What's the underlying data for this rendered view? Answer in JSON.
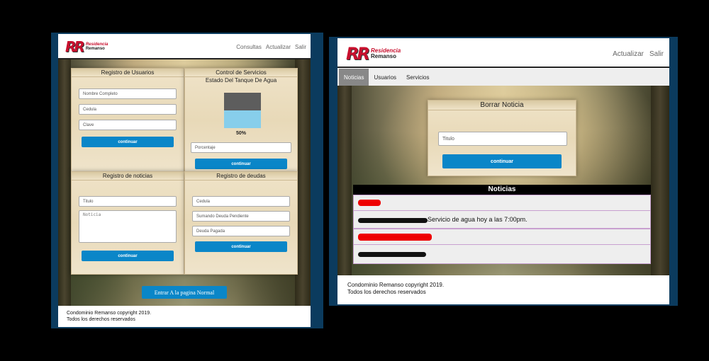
{
  "left": {
    "logo": {
      "mark": "RR",
      "line1": "Residencia",
      "line2": "Remanso"
    },
    "nav": [
      "Consultas",
      "Actualizar",
      "Salir"
    ],
    "usuarios": {
      "title": "Registro de Usuarios",
      "fields": [
        "Nombre Completo",
        "Cedula",
        "Clave"
      ],
      "button": "continuar"
    },
    "servicios": {
      "title": "Control de Servicios",
      "subtitle": "Estado Del Tanque De Agua",
      "level_percent": 50,
      "level_label": "50%",
      "field": "Porcentaje",
      "button": "continuar"
    },
    "noticias": {
      "title": "Registro de noticias",
      "field": "Titulo",
      "textarea": "Noticia",
      "button": "continuar"
    },
    "deudas": {
      "title": "Registro de deudas",
      "fields": [
        "Cedula",
        "Sumando Deuda Pendiente",
        "Deuda Pagada"
      ],
      "button": "continuar"
    },
    "enter_button": "Entrar A la pagina Normal",
    "footer": [
      "Condominio Remanso copyright 2019.",
      "Todos los derechos reservados"
    ]
  },
  "right": {
    "logo": {
      "mark": "RR",
      "line1": "Residencia",
      "line2": "Remanso"
    },
    "nav": [
      "Actualizar",
      "Salir"
    ],
    "tabs": [
      "Noticias",
      "Usuarios",
      "Servicios"
    ],
    "borrar": {
      "title": "Borrar Noticia",
      "field": "Titulo",
      "button": "continuar"
    },
    "news": {
      "header": "Noticias",
      "item1_body": "Servicio de agua hoy a las 7:00pm."
    },
    "footer": [
      "Condominio Remanso copyright 2019.",
      "Todos los derechos reservados"
    ]
  },
  "colors": {
    "accent": "#0a86c8",
    "brand": "#c8102e",
    "frame": "#0b3b5e"
  }
}
